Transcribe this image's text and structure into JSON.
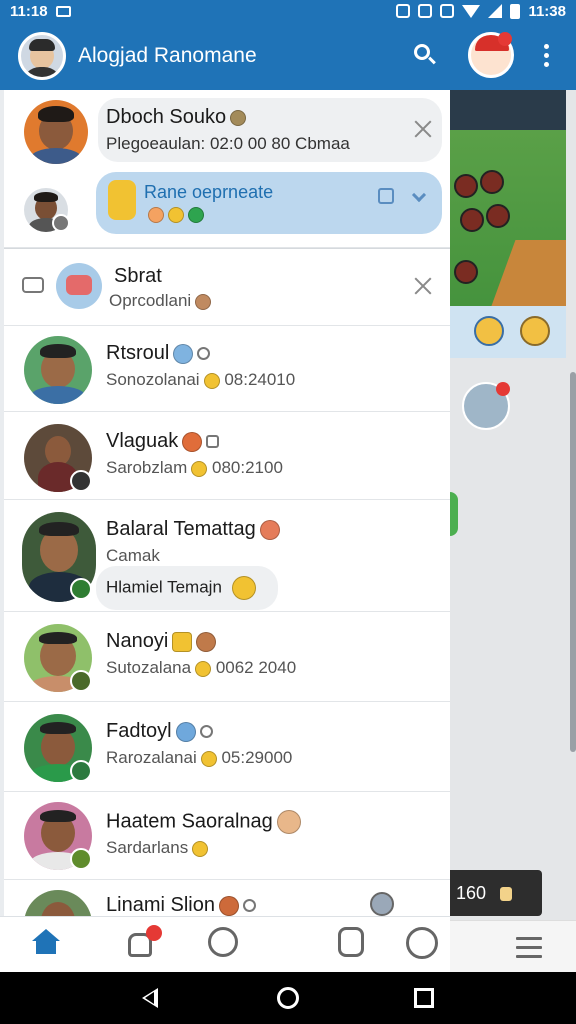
{
  "status_bar": {
    "time_left": "11:18",
    "time_right": "11:38"
  },
  "header": {
    "title": "Alogjad Ranomane"
  },
  "pinned": {
    "name": "Dboch Souko",
    "subtitle": "Plegoeaulan: 02:0 00 80 Cbmaa",
    "reply": {
      "text": "Rane oeprneate"
    }
  },
  "group": {
    "name": "Sbrat",
    "subtitle": "Oprcodlani"
  },
  "chats": [
    {
      "name": "Rtsroul",
      "subtitle": "Sonozolanai",
      "time": "08:24010",
      "color": "#4a9b6c"
    },
    {
      "name": "Vlaguak",
      "subtitle": "Sarobzlam",
      "time": "080:2100",
      "color": "#7d2a2a"
    },
    {
      "name": "Balaral Temattag",
      "subtitle": "Camak",
      "reply": "Hlamiel Temajn",
      "color": "#2a6a3a"
    },
    {
      "name": "Nanoyi",
      "subtitle": "Sutozalana",
      "time": "0062 2040",
      "color": "#6c8a3a"
    },
    {
      "name": "Fadtoyl",
      "subtitle": "Rarozalanai",
      "time": "05:29000",
      "color": "#2c7a3f"
    },
    {
      "name": "Haatem Saoralnag",
      "subtitle": "Sardarlans",
      "color": "#5f8c2c"
    },
    {
      "name": "Linami Slion",
      "subtitle": "",
      "color": "#cd6a3a"
    }
  ],
  "background_app": {
    "score": "160"
  }
}
